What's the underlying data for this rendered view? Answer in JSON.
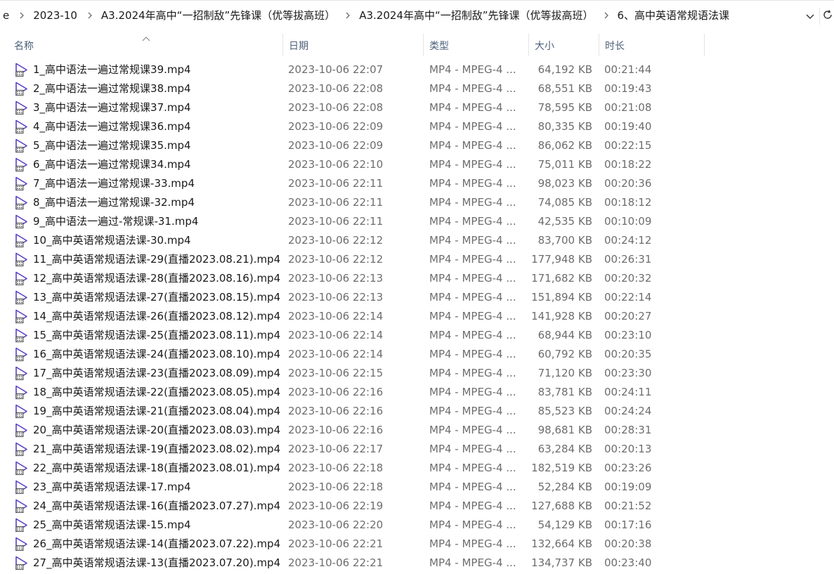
{
  "breadcrumb": {
    "items": [
      "e",
      "2023-10",
      "A3.2024年高中“一招制敌”先锋课（优等拔高班）",
      "A3.2024年高中“一招制敌”先锋课（优等拔高班）",
      "6、高中英语常规语法课"
    ]
  },
  "columns": {
    "name": "名称",
    "date": "日期",
    "type": "类型",
    "size": "大小",
    "duration": "时长"
  },
  "icons": {
    "file": "video-file-icon",
    "separator": "chevron-right-icon",
    "dropdown": "chevron-down-icon",
    "refresh": "refresh-icon",
    "sort": "sort-ascending-icon"
  },
  "colors": {
    "icon_accent": "#5b3fc4"
  },
  "files": [
    {
      "name": "1_高中语法一遍过常规课39.mp4",
      "date": "2023-10-06 22:07",
      "type": "MP4 - MPEG-4 ...",
      "size": "64,192 KB",
      "duration": "00:21:44"
    },
    {
      "name": "2_高中语法一遍过常规课38.mp4",
      "date": "2023-10-06 22:08",
      "type": "MP4 - MPEG-4 ...",
      "size": "68,551 KB",
      "duration": "00:19:43"
    },
    {
      "name": "3_高中语法一遍过常规课37.mp4",
      "date": "2023-10-06 22:08",
      "type": "MP4 - MPEG-4 ...",
      "size": "78,595 KB",
      "duration": "00:21:08"
    },
    {
      "name": "4_高中语法一遍过常规课36.mp4",
      "date": "2023-10-06 22:09",
      "type": "MP4 - MPEG-4 ...",
      "size": "80,335 KB",
      "duration": "00:19:40"
    },
    {
      "name": "5_高中语法一遍过常规课35.mp4",
      "date": "2023-10-06 22:09",
      "type": "MP4 - MPEG-4 ...",
      "size": "86,062 KB",
      "duration": "00:22:15"
    },
    {
      "name": "6_高中语法一遍过常规课34.mp4",
      "date": "2023-10-06 22:10",
      "type": "MP4 - MPEG-4 ...",
      "size": "75,011 KB",
      "duration": "00:18:22"
    },
    {
      "name": "7_高中语法一遍过常规课-33.mp4",
      "date": "2023-10-06 22:11",
      "type": "MP4 - MPEG-4 ...",
      "size": "98,023 KB",
      "duration": "00:20:36"
    },
    {
      "name": "8_高中语法一遍过常规课-32.mp4",
      "date": "2023-10-06 22:11",
      "type": "MP4 - MPEG-4 ...",
      "size": "74,085 KB",
      "duration": "00:18:12"
    },
    {
      "name": "9_高中语法一遍过-常规课-31.mp4",
      "date": "2023-10-06 22:11",
      "type": "MP4 - MPEG-4 ...",
      "size": "42,535 KB",
      "duration": "00:10:09"
    },
    {
      "name": "10_高中英语常规语法课-30.mp4",
      "date": "2023-10-06 22:12",
      "type": "MP4 - MPEG-4 ...",
      "size": "83,700 KB",
      "duration": "00:24:12"
    },
    {
      "name": "11_高中英语常规语法课-29(直播2023.08.21).mp4",
      "date": "2023-10-06 22:12",
      "type": "MP4 - MPEG-4 ...",
      "size": "177,948 KB",
      "duration": "00:26:31"
    },
    {
      "name": "12_高中英语常规语法课-28(直播2023.08.16).mp4",
      "date": "2023-10-06 22:13",
      "type": "MP4 - MPEG-4 ...",
      "size": "171,682 KB",
      "duration": "00:20:32"
    },
    {
      "name": "13_高中英语常规语法课-27(直播2023.08.15).mp4",
      "date": "2023-10-06 22:13",
      "type": "MP4 - MPEG-4 ...",
      "size": "151,894 KB",
      "duration": "00:22:14"
    },
    {
      "name": "14_高中英语常规语法课-26(直播2023.08.12).mp4",
      "date": "2023-10-06 22:14",
      "type": "MP4 - MPEG-4 ...",
      "size": "141,928 KB",
      "duration": "00:20:27"
    },
    {
      "name": "15_高中英语常规语法课-25(直播2023.08.11).mp4",
      "date": "2023-10-06 22:14",
      "type": "MP4 - MPEG-4 ...",
      "size": "68,944 KB",
      "duration": "00:23:10"
    },
    {
      "name": "16_高中英语常规语法课-24(直播2023.08.10).mp4",
      "date": "2023-10-06 22:14",
      "type": "MP4 - MPEG-4 ...",
      "size": "60,792 KB",
      "duration": "00:20:35"
    },
    {
      "name": "17_高中英语常规语法课-23(直播2023.08.09).mp4",
      "date": "2023-10-06 22:15",
      "type": "MP4 - MPEG-4 ...",
      "size": "71,120 KB",
      "duration": "00:23:30"
    },
    {
      "name": "18_高中英语常规语法课-22(直播2023.08.05).mp4",
      "date": "2023-10-06 22:16",
      "type": "MP4 - MPEG-4 ...",
      "size": "83,781 KB",
      "duration": "00:24:11"
    },
    {
      "name": "19_高中英语常规语法课-21(直播2023.08.04).mp4",
      "date": "2023-10-06 22:16",
      "type": "MP4 - MPEG-4 ...",
      "size": "85,523 KB",
      "duration": "00:24:24"
    },
    {
      "name": "20_高中英语常规语法课-20(直播2023.08.03).mp4",
      "date": "2023-10-06 22:16",
      "type": "MP4 - MPEG-4 ...",
      "size": "98,681 KB",
      "duration": "00:28:31"
    },
    {
      "name": "21_高中英语常规语法课-19(直播2023.08.02).mp4",
      "date": "2023-10-06 22:17",
      "type": "MP4 - MPEG-4 ...",
      "size": "63,284 KB",
      "duration": "00:20:13"
    },
    {
      "name": "22_高中英语常规语法课-18(直播2023.08.01).mp4",
      "date": "2023-10-06 22:18",
      "type": "MP4 - MPEG-4 ...",
      "size": "182,519 KB",
      "duration": "00:23:26"
    },
    {
      "name": "23_高中英语常规语法课-17.mp4",
      "date": "2023-10-06 22:18",
      "type": "MP4 - MPEG-4 ...",
      "size": "52,284 KB",
      "duration": "00:19:09"
    },
    {
      "name": "24_高中英语常规语法课-16(直播2023.07.27).mp4",
      "date": "2023-10-06 22:19",
      "type": "MP4 - MPEG-4 ...",
      "size": "127,688 KB",
      "duration": "00:21:52"
    },
    {
      "name": "25_高中英语常规语法课-15.mp4",
      "date": "2023-10-06 22:20",
      "type": "MP4 - MPEG-4 ...",
      "size": "54,129 KB",
      "duration": "00:17:16"
    },
    {
      "name": "26_高中英语常规语法课-14(直播2023.07.22).mp4",
      "date": "2023-10-06 22:21",
      "type": "MP4 - MPEG-4 ...",
      "size": "132,664 KB",
      "duration": "00:20:38"
    },
    {
      "name": "27_高中英语常规语法课-13(直播2023.07.20).mp4",
      "date": "2023-10-06 22:21",
      "type": "MP4 - MPEG-4 ...",
      "size": "134,737 KB",
      "duration": "00:23:40"
    }
  ]
}
